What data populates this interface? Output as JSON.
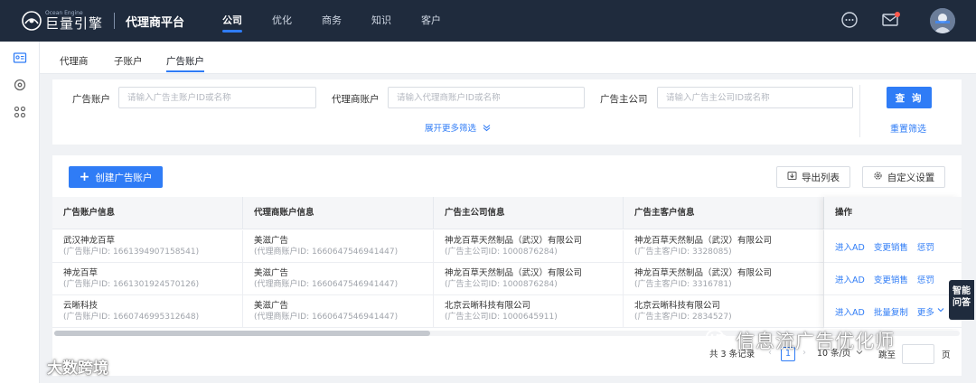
{
  "header": {
    "logo_en": "Ocean Engine",
    "logo_cn": "巨量引擎",
    "platform": "代理商平台",
    "nav": [
      {
        "label": "公司",
        "active": true
      },
      {
        "label": "优化",
        "active": false
      },
      {
        "label": "商务",
        "active": false
      },
      {
        "label": "知识",
        "active": false
      },
      {
        "label": "客户",
        "active": false
      }
    ],
    "icons": [
      "more-circle-icon",
      "mail-icon",
      "avatar"
    ],
    "accent": "#2f7cf6",
    "bg": "#1f2b3d"
  },
  "rail": {
    "icons": [
      "id-card-icon",
      "target-icon",
      "connect-icon"
    ]
  },
  "subtabs": [
    {
      "label": "代理商",
      "active": false
    },
    {
      "label": "子账户",
      "active": false
    },
    {
      "label": "广告账户",
      "active": true
    }
  ],
  "filters": {
    "ad_account": {
      "label": "广告账户",
      "placeholder": "请输入广告主账户ID或名称"
    },
    "agent_account": {
      "label": "代理商账户",
      "placeholder": "请输入代理商账户ID或名称"
    },
    "advertiser_company": {
      "label": "广告主公司",
      "placeholder": "请输入广告主公司ID或名称"
    },
    "query_label": "查 询",
    "reset_label": "重置筛选",
    "expand_label": "展开更多筛选"
  },
  "toolbar": {
    "create_label": "创建广告账户",
    "export_label": "导出列表",
    "customize_label": "自定义设置"
  },
  "table": {
    "headers": [
      "广告账户信息",
      "代理商账户信息",
      "广告主公司信息",
      "广告主客户信息"
    ],
    "op_header": "操作",
    "rows": [
      {
        "account": {
          "name": "武汉神龙百草",
          "id": "(广告账户ID: 1661394907158541)"
        },
        "agent": {
          "name": "美滋广告",
          "id": "(代理商账户ID: 1660647546941447)"
        },
        "company": {
          "name": "神龙百草天然制品（武汉）有限公司",
          "id": "(广告主公司ID: 1000876284)"
        },
        "customer": {
          "name": "神龙百草天然制品（武汉）有限公司",
          "id": "(广告主客户ID: 3328085)"
        },
        "ops": [
          "进入AD",
          "变更销售",
          "惩罚"
        ]
      },
      {
        "account": {
          "name": "神龙百草",
          "id": "(广告账户ID: 1661301924570126)"
        },
        "agent": {
          "name": "美滋广告",
          "id": "(代理商账户ID: 1660647546941447)"
        },
        "company": {
          "name": "神龙百草天然制品（武汉）有限公司",
          "id": "(广告主公司ID: 1000876284)"
        },
        "customer": {
          "name": "神龙百草天然制品（武汉）有限公司",
          "id": "(广告主客户ID: 3316781)"
        },
        "ops": [
          "进入AD",
          "变更销售",
          "惩罚"
        ]
      },
      {
        "account": {
          "name": "云晰科技",
          "id": "(广告账户ID: 1660746995312648)"
        },
        "agent": {
          "name": "美滋广告",
          "id": "(代理商账户ID: 1660647546941447)"
        },
        "company": {
          "name": "北京云晰科技有限公司",
          "id": "(广告主公司ID: 1000645911)"
        },
        "customer": {
          "name": "北京云晰科技有限公司",
          "id": "(广告主客户ID: 2834527)"
        },
        "ops": [
          "进入AD",
          "批量复制",
          "更多"
        ]
      }
    ]
  },
  "pagination": {
    "total": "共 3 条记录",
    "current": "1",
    "page_size": "10 条/页",
    "jump_label": "跳至",
    "page_suffix": "页"
  },
  "assistant": {
    "line1": "智能",
    "line2": "问答"
  },
  "watermark_right": "信息流广告优化师",
  "watermark_left": "大数跨境"
}
